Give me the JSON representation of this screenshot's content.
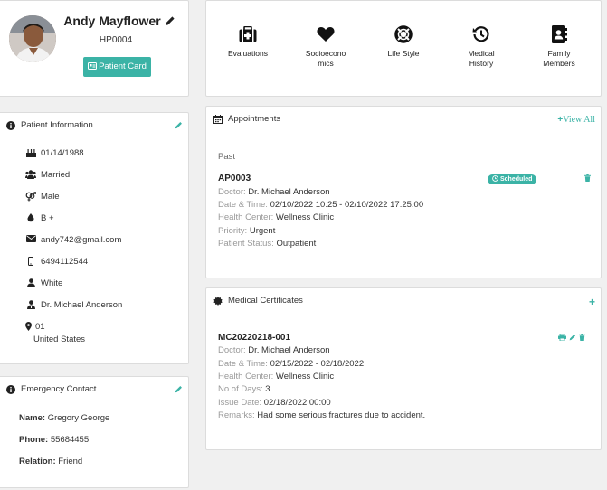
{
  "profile": {
    "name": "Andy Mayflower",
    "patient_id": "HP0004",
    "patient_card_label": "Patient Card"
  },
  "nav": {
    "items": [
      {
        "label_lines": [
          "Evaluations"
        ],
        "icon": "first-aid-kit-icon"
      },
      {
        "label_lines": [
          "Socioecono",
          "mics"
        ],
        "icon": "heart-icon"
      },
      {
        "label_lines": [
          "Life Style"
        ],
        "icon": "life-ring-icon"
      },
      {
        "label_lines": [
          "Medical",
          "History"
        ],
        "icon": "history-icon"
      },
      {
        "label_lines": [
          "Family",
          "Members"
        ],
        "icon": "address-book-icon"
      }
    ]
  },
  "patient_info": {
    "title": "Patient Information",
    "dob": "01/14/1988",
    "marital_status": "Married",
    "gender": "Male",
    "blood_type": "B +",
    "email": "andy742@gmail.com",
    "phone": "6494112544",
    "race": "White",
    "doctor": "Dr. Michael Anderson",
    "address_line1": "01",
    "address_line2": "United States"
  },
  "emergency": {
    "title": "Emergency Contact",
    "name_label": "Name:",
    "name": "Gregory George",
    "phone_label": "Phone:",
    "phone": "55684455",
    "relation_label": "Relation:",
    "relation": "Friend"
  },
  "appointments": {
    "title": "Appointments",
    "view_all": "View All",
    "section": "Past",
    "item": {
      "id": "AP0003",
      "status": "Scheduled",
      "doctor_label": "Doctor:",
      "doctor": "Dr. Michael Anderson",
      "datetime_label": "Date & Time:",
      "datetime": "02/10/2022 10:25 - 02/10/2022 17:25:00",
      "center_label": "Health Center:",
      "center": "Wellness Clinic",
      "priority_label": "Priority:",
      "priority": "Urgent",
      "pstatus_label": "Patient Status:",
      "pstatus": "Outpatient"
    }
  },
  "certificates": {
    "title": "Medical Certificates",
    "item": {
      "id": "MC20220218-001",
      "doctor_label": "Doctor:",
      "doctor": "Dr. Michael Anderson",
      "datetime_label": "Date & Time:",
      "datetime": "02/15/2022 - 02/18/2022",
      "center_label": "Health Center:",
      "center": "Wellness Clinic",
      "days_label": "No of Days:",
      "days": "3",
      "issue_label": "Issue Date:",
      "issue": "02/18/2022 00:00",
      "remarks_label": "Remarks:",
      "remarks": "Had some serious fractures due to accident."
    }
  },
  "colors": {
    "accent": "#3bb3a6",
    "muted_label": "#999999"
  }
}
